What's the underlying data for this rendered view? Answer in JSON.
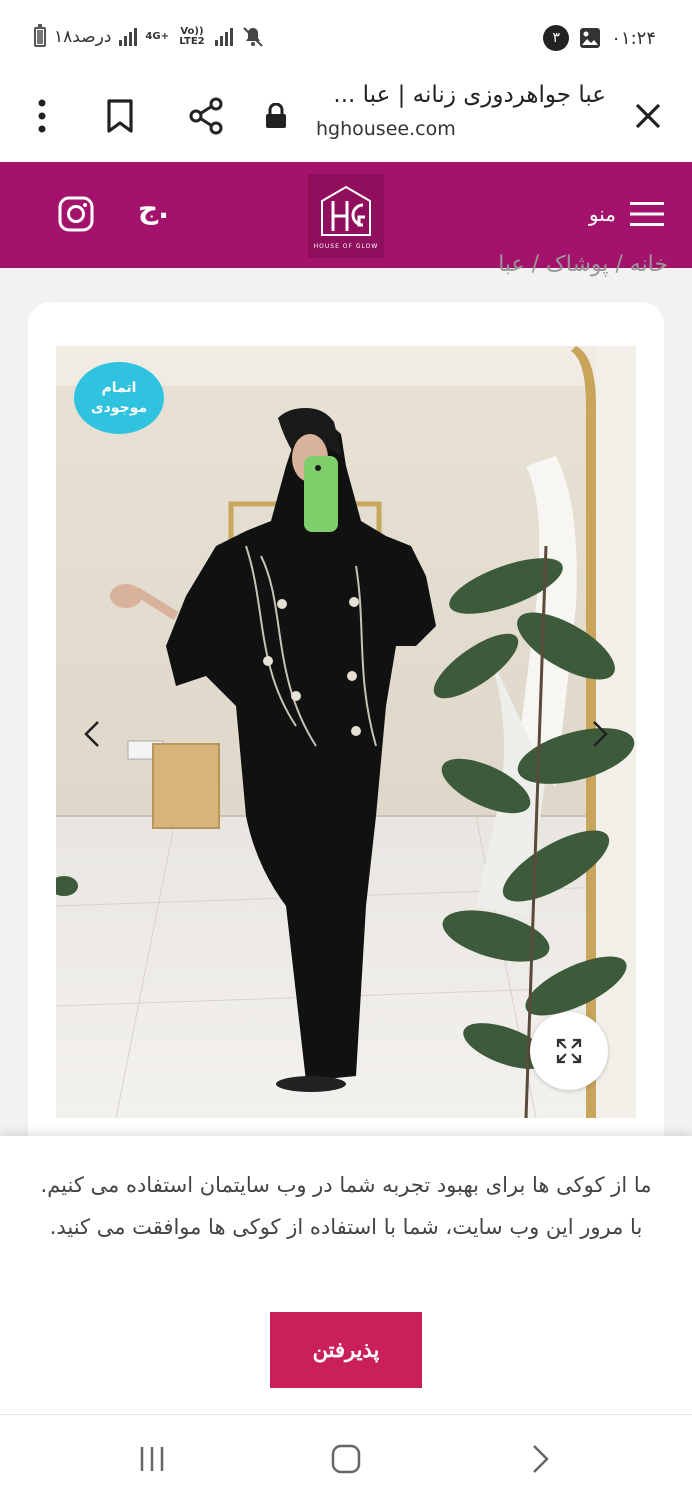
{
  "status_bar": {
    "time": "۰۱:۲۴",
    "notification_count": "۳",
    "battery_text": "۱۸درصد",
    "network_1": "4G+",
    "network_2": "Vo)) LTE2"
  },
  "browser": {
    "page_title": "عبا جواهردوزی زنانه | عبا ...",
    "domain": "hghousee.com"
  },
  "site_header": {
    "menu_label": "منو",
    "logo_subtitle": "HOUSE OF GLOW",
    "cart_label": "ج.",
    "brand_color": "#a3136b"
  },
  "breadcrumb": {
    "text": "خانه / پوشاک / عبا"
  },
  "product": {
    "stock_badge": "اتمام موجودی",
    "badge_color": "#2fc3e0"
  },
  "cookie_banner": {
    "message": "ما از کوکی ها برای بهبود تجربه شما در وب سایتمان استفاده می کنیم. با مرور این وب سایت، شما با استفاده از کوکی ها موافقت می کنید.",
    "accept_label": "پذیرفتن",
    "accept_color": "#c91f5a"
  }
}
